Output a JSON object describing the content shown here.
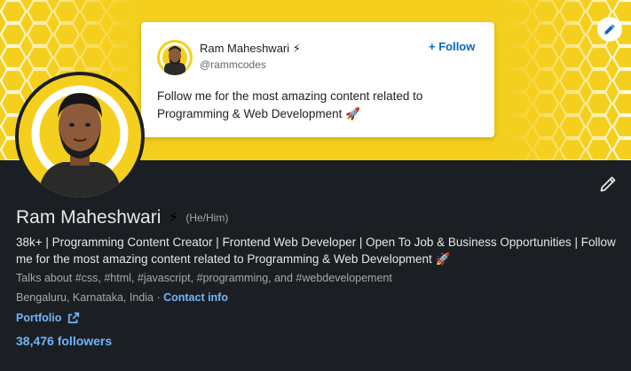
{
  "banner": {
    "card": {
      "name": "Ram Maheshwari",
      "name_emoji": "⚡",
      "handle": "@rammcodes",
      "follow_label": "+ Follow",
      "text": "Follow me for the most amazing content related to Programming & Web Development 🚀"
    },
    "edit_icon": "pencil-icon"
  },
  "profile": {
    "name": "Ram Maheshwari",
    "name_emoji": "⚡",
    "pronouns": "(He/Him)",
    "headline": "38k+ | Programming Content Creator | Frontend Web Developer | Open To Job & Business Opportunities | Follow me for the most amazing content related to Programming & Web Development 🚀",
    "talks_about": "Talks about #css, #html, #javascript, #programming, and #webdevelopement",
    "location": "Bengaluru, Karnataka, India · ",
    "contact_label": "Contact info",
    "portfolio_label": "Portfolio",
    "followers": "38,476 followers",
    "edit_icon": "pencil-icon"
  },
  "colors": {
    "banner_yellow": "#f5cf1d",
    "background": "#1b1f23",
    "link_blue": "#70b5f9",
    "follow_blue": "#0a66c2"
  }
}
